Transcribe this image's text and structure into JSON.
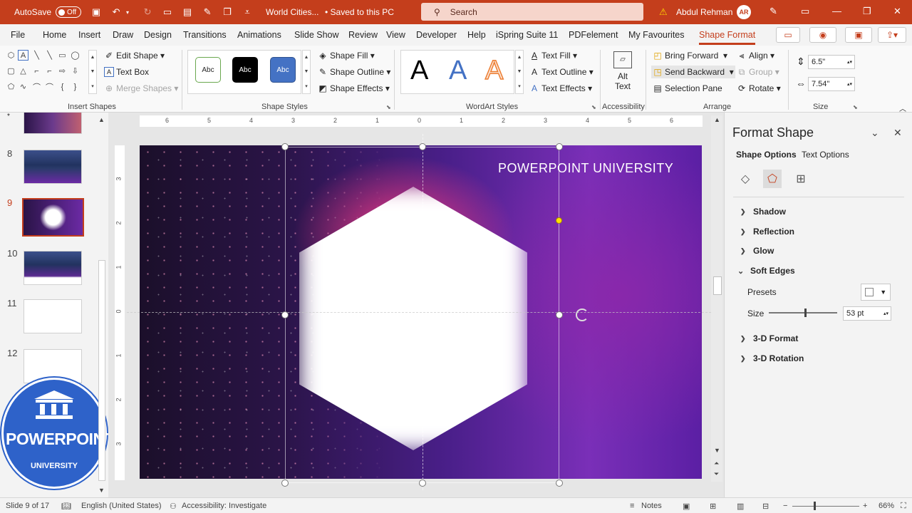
{
  "titlebar": {
    "autosave_label": "AutoSave",
    "autosave_state": "Off",
    "doc_title": "World Cities...",
    "save_state": "• Saved to this PC",
    "search_placeholder": "Search",
    "user_name": "Abdul Rehman",
    "user_initials": "AR"
  },
  "menu": {
    "tabs": [
      "File",
      "Home",
      "Insert",
      "Draw",
      "Design",
      "Transitions",
      "Animations",
      "Slide Show",
      "Review",
      "View",
      "Developer",
      "Help",
      "iSpring Suite 11",
      "PDFelement",
      "My Favourites",
      "Shape Format"
    ],
    "active_tab": "Shape Format"
  },
  "ribbon": {
    "insert_shapes": {
      "label": "Insert Shapes",
      "edit_shape": "Edit Shape",
      "text_box": "Text Box",
      "merge_shapes": "Merge Shapes"
    },
    "shape_styles": {
      "label": "Shape Styles",
      "swatch_text": "Abc",
      "shape_fill": "Shape Fill",
      "shape_outline": "Shape Outline",
      "shape_effects": "Shape Effects"
    },
    "wordart_styles": {
      "label": "WordArt Styles",
      "letter": "A",
      "text_fill": "Text Fill",
      "text_outline": "Text Outline",
      "text_effects": "Text Effects"
    },
    "accessibility": {
      "label": "Accessibility",
      "alt_text_line1": "Alt",
      "alt_text_line2": "Text"
    },
    "arrange": {
      "label": "Arrange",
      "bring_forward": "Bring Forward",
      "send_backward": "Send Backward",
      "selection_pane": "Selection Pane",
      "align": "Align",
      "group": "Group",
      "rotate": "Rotate"
    },
    "size": {
      "label": "Size",
      "height": "6.5\"",
      "width": "7.54\""
    }
  },
  "thumbnails": {
    "numbers": [
      "8",
      "9",
      "10",
      "11",
      "12"
    ],
    "selected": "9"
  },
  "logo": {
    "line1": "POWERPOINT",
    "line2": "UNIVERSITY"
  },
  "slide": {
    "title": "POWERPOINT UNIVERSITY"
  },
  "rulers": {
    "horizontal": [
      "6",
      "5",
      "4",
      "3",
      "2",
      "1",
      "0",
      "1",
      "2",
      "3",
      "4",
      "5",
      "6"
    ],
    "vertical": [
      "3",
      "2",
      "1",
      "0",
      "1",
      "2",
      "3"
    ]
  },
  "format_pane": {
    "title": "Format Shape",
    "tab_shape": "Shape Options",
    "tab_text": "Text Options",
    "sections": {
      "shadow": "Shadow",
      "reflection": "Reflection",
      "glow": "Glow",
      "soft_edges": "Soft Edges",
      "format_3d": "3-D Format",
      "rotation_3d": "3-D Rotation"
    },
    "presets_label": "Presets",
    "size_label": "Size",
    "size_value": "53 pt",
    "size_fraction": 0.53
  },
  "status": {
    "slide_info": "Slide 9 of 17",
    "language": "English (United States)",
    "accessibility": "Accessibility: Investigate",
    "notes": "Notes",
    "zoom": "66%"
  },
  "colors": {
    "accent": "#c43e1c",
    "search_bg": "#f6d5cb",
    "logo_blue": "#2e62c9"
  }
}
